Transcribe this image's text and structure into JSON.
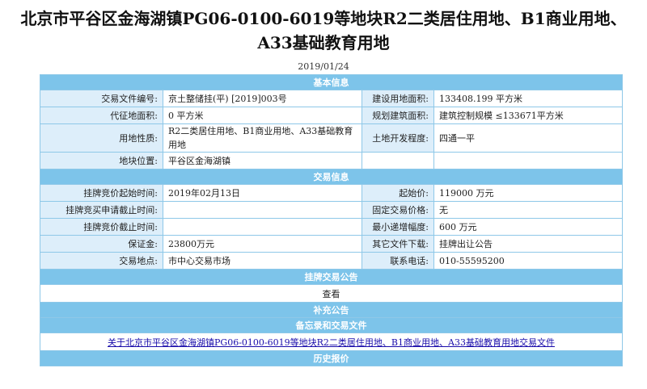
{
  "page": {
    "title": "北京市平谷区金海湖镇PG06-0100-6019等地块R2二类居住用地、B1商业用地、A33基础教育用地",
    "date": "2019/01/24"
  },
  "sections": {
    "basic": "基本信息",
    "trade": "交易信息",
    "announcement": "挂牌交易公告",
    "supplement": "补充公告",
    "memo": "备忘录和交易文件",
    "history": "历史报价"
  },
  "basic": {
    "file_no_label": "交易文件编号:",
    "file_no": "京土整储挂(平) [2019]003号",
    "construction_area_label": "建设用地面积:",
    "construction_area": "133408.199 平方米",
    "expropriation_area_label": "代征地面积:",
    "expropriation_area": "0 平方米",
    "planned_area_label": "规划建筑面积:",
    "planned_area": "建筑控制规模 ≤133671平方米",
    "land_use_label": "用地性质:",
    "land_use": "R2二类居住用地、B1商业用地、A33基础教育用地",
    "development_label": "土地开发程度:",
    "development": "四通一平",
    "location_label": "地块位置:",
    "location": "平谷区金海湖镇",
    "location_extra": ""
  },
  "trade": {
    "start_time_label": "挂牌竞价起始时间:",
    "start_time": "2019年02月13日",
    "start_price_label": "起始价:",
    "start_price": "119000 万元",
    "apply_deadline_label": "挂牌竞买申请截止时间:",
    "apply_deadline": "",
    "fixed_price_label": "固定交易价格:",
    "fixed_price": "无",
    "bid_deadline_label": "挂牌竞价截止时间:",
    "bid_deadline": "",
    "min_increment_label": "最小递增幅度:",
    "min_increment": "600 万元",
    "deposit_label": "保证金:",
    "deposit": "23800万元",
    "other_files_label": "其它文件下载:",
    "other_files": "挂牌出让公告",
    "place_label": "交易地点:",
    "place": "市中心交易市场",
    "phone_label": "联系电话:",
    "phone": "010-55595200"
  },
  "announcement": {
    "view_label": "查看"
  },
  "memo": {
    "doc_link": "关于北京市平谷区金海湖镇PG06-0100-6019等地块R2二类居住用地、B1商业用地、A33基础教育用地交易文件"
  },
  "colors": {
    "section_bg": "#7dc4ea",
    "label_bg": "#ddeefa",
    "border": "#8ec8e8",
    "link": "#1a0dab"
  }
}
